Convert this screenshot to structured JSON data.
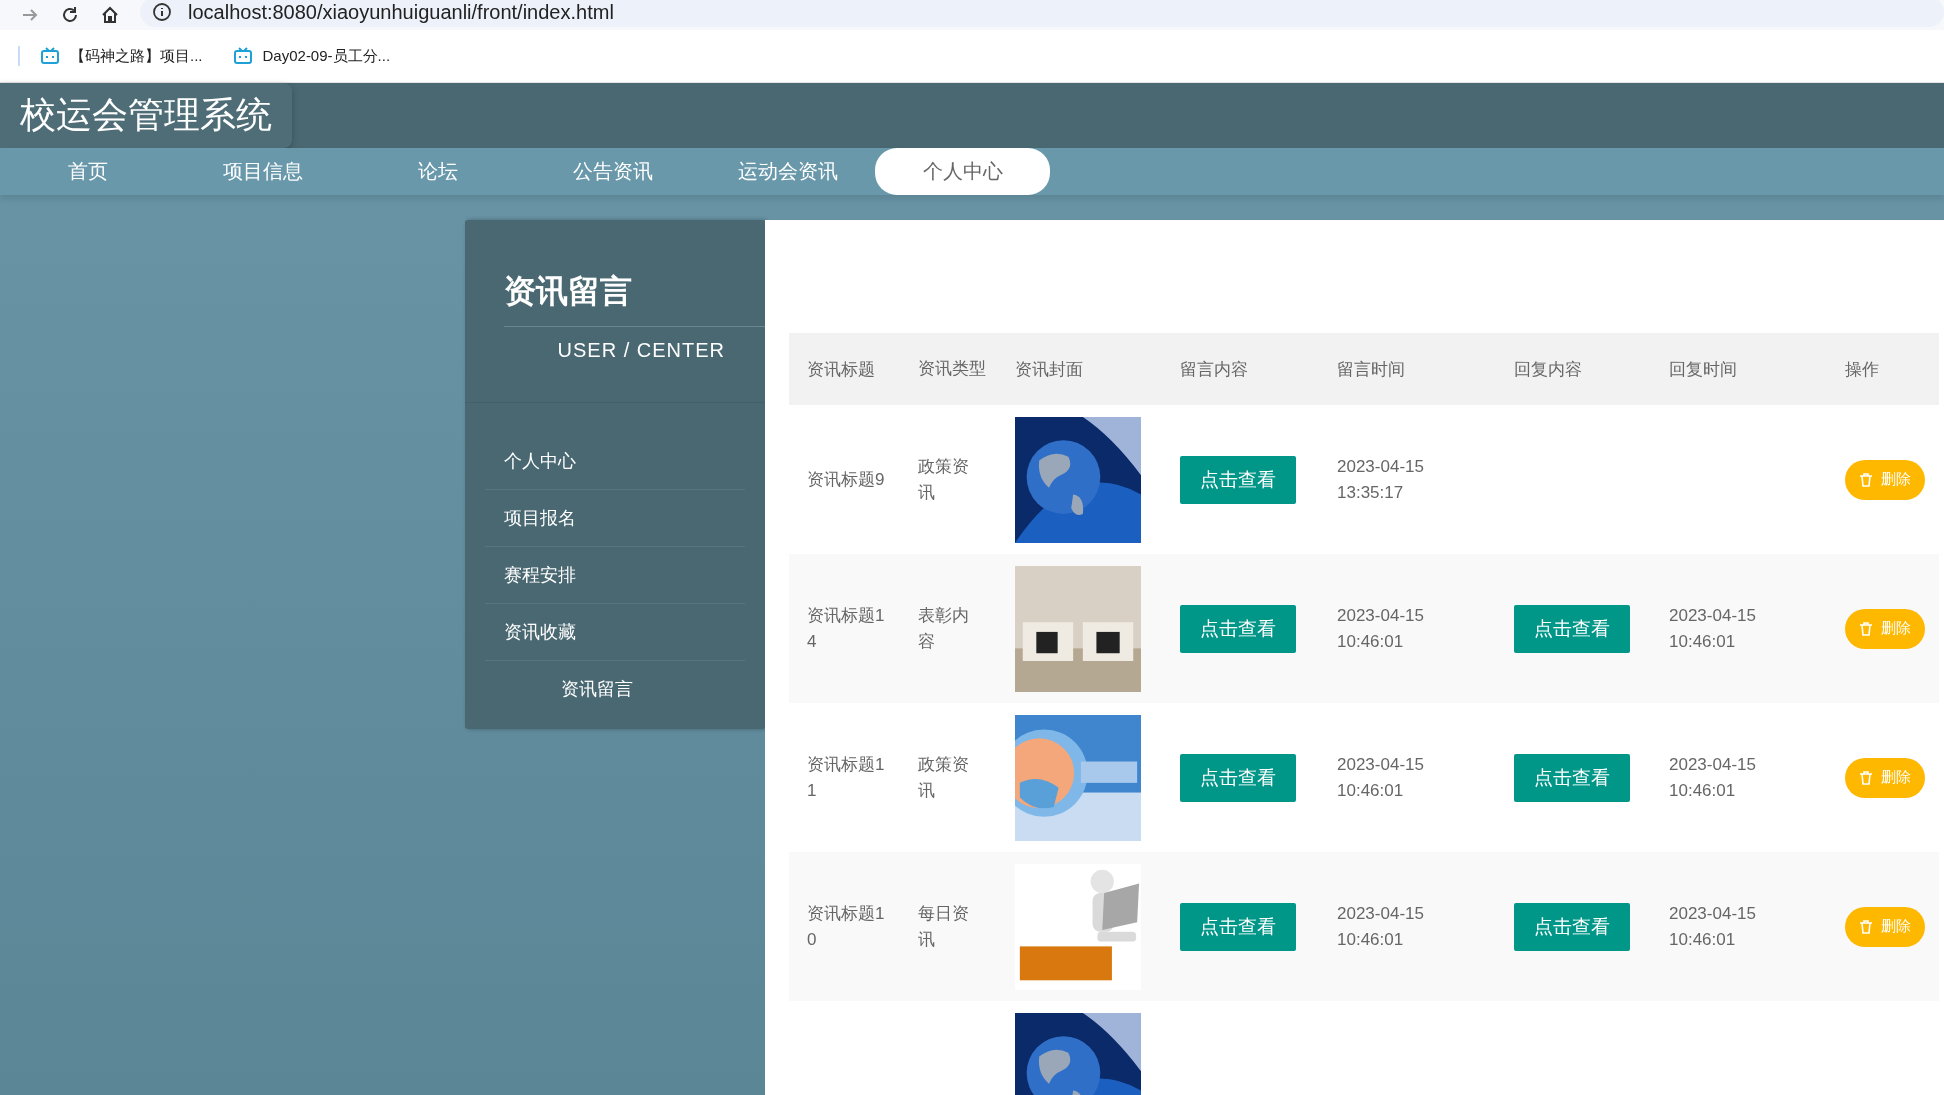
{
  "browser": {
    "url": "localhost:8080/xiaoyunhuiguanli/front/index.html",
    "bookmarks": [
      "【码神之路】项目...",
      "Day02-09-员工分..."
    ]
  },
  "site": {
    "title": "校运会管理系统"
  },
  "nav": [
    {
      "label": "首页",
      "selected": false
    },
    {
      "label": "项目信息",
      "selected": false
    },
    {
      "label": "论坛",
      "selected": false
    },
    {
      "label": "公告资讯",
      "selected": false
    },
    {
      "label": "运动会资讯",
      "selected": false
    },
    {
      "label": "个人中心",
      "selected": true
    }
  ],
  "sidebar": {
    "title": "资讯留言",
    "subtitle": "USER / CENTER",
    "items": [
      {
        "label": "个人中心",
        "selected": false
      },
      {
        "label": "项目报名",
        "selected": false
      },
      {
        "label": "赛程安排",
        "selected": false
      },
      {
        "label": "资讯收藏",
        "selected": false
      },
      {
        "label": "资讯留言",
        "selected": true
      }
    ]
  },
  "table": {
    "columns": [
      "资讯标题",
      "资讯类型",
      "资讯封面",
      "留言内容",
      "留言时间",
      "回复内容",
      "回复时间",
      "操作"
    ],
    "rows": [
      {
        "title": "资讯标题9",
        "type": "政策资讯",
        "cover": {
          "kind": "picture"
        },
        "message_button": "点击查看",
        "time": "2023-04-15 13:35:17",
        "delete_button": "删除"
      },
      {
        "title": "资讯标题14",
        "type": "表彰内容",
        "cover": {
          "kind": "picture"
        },
        "message_button": "点击查看",
        "time": "2023-04-15 10:46:01",
        "reply_button": "点击查看",
        "reply_time": "2023-04-15 10:46:01",
        "delete_button": "删除"
      },
      {
        "title": "资讯标题11",
        "type": "政策资讯",
        "cover": {
          "kind": "picture"
        },
        "message_button": "点击查看",
        "time": "2023-04-15 10:46:01",
        "reply_button": "点击查看",
        "reply_time": "2023-04-15 10:46:01",
        "delete_button": "删除"
      },
      {
        "title": "资讯标题10",
        "type": "每日资讯",
        "cover": {
          "kind": "picture"
        },
        "message_button": "点击查看",
        "time": "2023-04-15 10:46:01",
        "reply_button": "点击查看",
        "reply_time": "2023-04-15 10:46:01",
        "delete_button": "删除"
      },
      {
        "cover": {
          "kind": "picture"
        }
      }
    ]
  }
}
